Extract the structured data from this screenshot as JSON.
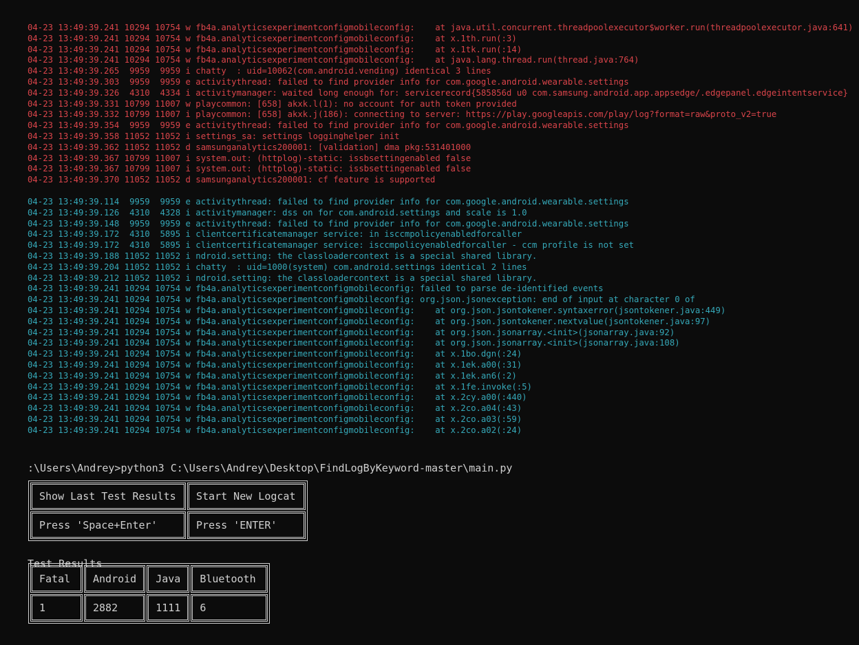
{
  "log_red": [
    "04-23 13:49:39.241 10294 10754 w fb4a.analyticsexperimentconfigmobileconfig:    at java.util.concurrent.threadpoolexecutor$worker.run(threadpoolexecutor.java:641)",
    "04-23 13:49:39.241 10294 10754 w fb4a.analyticsexperimentconfigmobileconfig:    at x.1th.run(:3)",
    "04-23 13:49:39.241 10294 10754 w fb4a.analyticsexperimentconfigmobileconfig:    at x.1tk.run(:14)",
    "04-23 13:49:39.241 10294 10754 w fb4a.analyticsexperimentconfigmobileconfig:    at java.lang.thread.run(thread.java:764)",
    "04-23 13:49:39.265  9959  9959 i chatty  : uid=10062(com.android.vending) identical 3 lines",
    "04-23 13:49:39.303  9959  9959 e activitythread: failed to find provider info for com.google.android.wearable.settings",
    "04-23 13:49:39.326  4310  4334 i activitymanager: waited long enough for: servicerecord{585856d u0 com.samsung.android.app.appsedge/.edgepanel.edgeintentservice}",
    "04-23 13:49:39.331 10799 11007 w playcommon: [658] akxk.l(1): no account for auth token provided",
    "04-23 13:49:39.332 10799 11007 i playcommon: [658] akxk.j(186): connecting to server: https://play.googleapis.com/play/log?format=raw&proto_v2=true",
    "04-23 13:49:39.354  9959  9959 e activitythread: failed to find provider info for com.google.android.wearable.settings",
    "04-23 13:49:39.358 11052 11052 i settings_sa: settings logginghelper init",
    "04-23 13:49:39.362 11052 11052 d samsunganalytics200001: [validation] dma pkg:531401000",
    "04-23 13:49:39.367 10799 11007 i system.out: (httplog)-static: issbsettingenabled false",
    "04-23 13:49:39.367 10799 11007 i system.out: (httplog)-static: issbsettingenabled false",
    "04-23 13:49:39.370 11052 11052 d samsunganalytics200001: cf feature is supported"
  ],
  "log_cyan": [
    "04-23 13:49:39.114  9959  9959 e activitythread: failed to find provider info for com.google.android.wearable.settings",
    "04-23 13:49:39.126  4310  4328 i activitymanager: dss on for com.android.settings and scale is 1.0",
    "04-23 13:49:39.148  9959  9959 e activitythread: failed to find provider info for com.google.android.wearable.settings",
    "04-23 13:49:39.172  4310  5895 i clientcertificatemanager service: in isccmpolicyenabledforcaller",
    "04-23 13:49:39.172  4310  5895 i clientcertificatemanager service: isccmpolicyenabledforcaller - ccm profile is not set",
    "04-23 13:49:39.188 11052 11052 i ndroid.setting: the classloadercontext is a special shared library.",
    "04-23 13:49:39.204 11052 11052 i chatty  : uid=1000(system) com.android.settings identical 2 lines",
    "04-23 13:49:39.212 11052 11052 i ndroid.setting: the classloadercontext is a special shared library.",
    "04-23 13:49:39.241 10294 10754 w fb4a.analyticsexperimentconfigmobileconfig: failed to parse de-identified events",
    "04-23 13:49:39.241 10294 10754 w fb4a.analyticsexperimentconfigmobileconfig: org.json.jsonexception: end of input at character 0 of",
    "04-23 13:49:39.241 10294 10754 w fb4a.analyticsexperimentconfigmobileconfig:    at org.json.jsontokener.syntaxerror(jsontokener.java:449)",
    "04-23 13:49:39.241 10294 10754 w fb4a.analyticsexperimentconfigmobileconfig:    at org.json.jsontokener.nextvalue(jsontokener.java:97)",
    "04-23 13:49:39.241 10294 10754 w fb4a.analyticsexperimentconfigmobileconfig:    at org.json.jsonarray.<init>(jsonarray.java:92)",
    "04-23 13:49:39.241 10294 10754 w fb4a.analyticsexperimentconfigmobileconfig:    at org.json.jsonarray.<init>(jsonarray.java:108)",
    "04-23 13:49:39.241 10294 10754 w fb4a.analyticsexperimentconfigmobileconfig:    at x.1bo.dgn(:24)",
    "04-23 13:49:39.241 10294 10754 w fb4a.analyticsexperimentconfigmobileconfig:    at x.1ek.a00(:31)",
    "04-23 13:49:39.241 10294 10754 w fb4a.analyticsexperimentconfigmobileconfig:    at x.1ek.an6(:2)",
    "04-23 13:49:39.241 10294 10754 w fb4a.analyticsexperimentconfigmobileconfig:    at x.1fe.invoke(:5)",
    "04-23 13:49:39.241 10294 10754 w fb4a.analyticsexperimentconfigmobileconfig:    at x.2cy.a00(:440)",
    "04-23 13:49:39.241 10294 10754 w fb4a.analyticsexperimentconfigmobileconfig:    at x.2co.a04(:43)",
    "04-23 13:49:39.241 10294 10754 w fb4a.analyticsexperimentconfigmobileconfig:    at x.2co.a03(:59)",
    "04-23 13:49:39.241 10294 10754 w fb4a.analyticsexperimentconfigmobileconfig:    at x.2co.a02(:24)"
  ],
  "command_line": ":\\Users\\Andrey>python3 C:\\Users\\Andrey\\Desktop\\FindLogByKeyword-master\\main.py",
  "menu": {
    "headers": [
      "Show Last Test Results",
      "Start New Logcat"
    ],
    "hints": [
      "Press 'Space+Enter'",
      "Press 'ENTER'"
    ]
  },
  "results": {
    "title": "Test Results",
    "headers": [
      "Fatal",
      "Android",
      "Java",
      "Bluetooth"
    ],
    "values": [
      "1",
      "2882",
      "1111",
      "6"
    ]
  },
  "colors": {
    "background": "#0c0c0c",
    "log_red": "#d9444a",
    "log_cyan": "#35a8b8",
    "text": "#d0d0d0"
  }
}
